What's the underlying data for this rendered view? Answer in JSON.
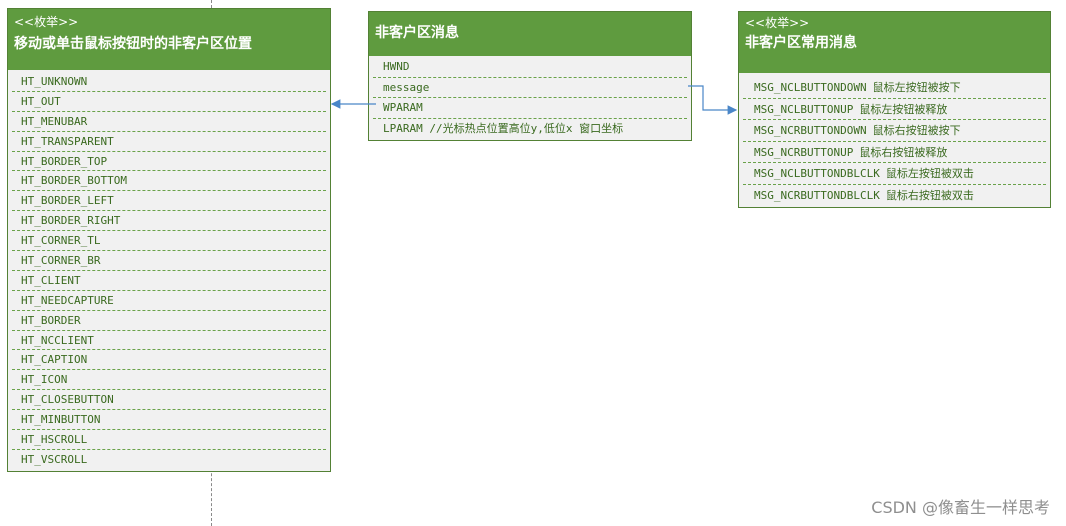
{
  "left_enum": {
    "stereotype": "<<枚举>>",
    "title": "移动或单击鼠标按钮时的非客户区位置",
    "items": [
      "HT_UNKNOWN",
      "HT_OUT",
      "HT_MENUBAR",
      "HT_TRANSPARENT",
      "HT_BORDER_TOP",
      "HT_BORDER_BOTTOM",
      "HT_BORDER_LEFT",
      "HT_BORDER_RIGHT",
      "HT_CORNER_TL",
      "HT_CORNER_BR",
      "HT_CLIENT",
      "HT_NEEDCAPTURE",
      "HT_BORDER",
      "HT_NCCLIENT",
      "HT_CAPTION",
      "HT_ICON",
      "HT_CLOSEBUTTON",
      "HT_MINBUTTON",
      "HT_HSCROLL",
      "HT_VSCROLL"
    ]
  },
  "struct": {
    "title": "非客户区消息",
    "fields": [
      "HWND",
      "message",
      "WPARAM",
      "LPARAM //光标热点位置高位y,低位x 窗口坐标"
    ]
  },
  "right_enum": {
    "stereotype": "<<枚举>>",
    "title": "非客户区常用消息",
    "items": [
      {
        "name": "MSG_NCLBUTTONDOWN",
        "desc": "鼠标左按钮被按下"
      },
      {
        "name": "MSG_NCLBUTTONUP",
        "desc": "鼠标左按钮被释放"
      },
      {
        "name": "MSG_NCRBUTTONDOWN",
        "desc": "鼠标右按钮被按下"
      },
      {
        "name": "MSG_NCRBUTTONUP",
        "desc": "鼠标右按钮被释放"
      },
      {
        "name": "MSG_NCLBUTTONDBLCLK",
        "desc": "鼠标左按钮被双击"
      },
      {
        "name": "MSG_NCRBUTTONDBLCLK",
        "desc": "鼠标右按钮被双击"
      }
    ]
  },
  "watermark": "CSDN @像畜生一样思考",
  "colors": {
    "header_fill": "#5f9b3f",
    "border": "#538135",
    "body_fill": "#f1f1f1",
    "text": "#3a6a1f",
    "arrow": "#4a86c8"
  }
}
